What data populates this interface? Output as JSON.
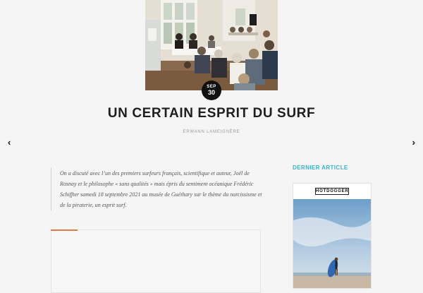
{
  "article": {
    "date_month": "SEP",
    "date_day": "30",
    "title": "UN CERTAIN ESPRIT DU SURF",
    "author": "ERWANN LAMEIGNÈRE",
    "intro": "On a discuté avec l’un des premiers surfeurs français, scientifique et auteur, Joël de Rosnay et le philosophe « sans qualités » mais épris du sentiment océanique Frédéric Schiffter samedi 18 septembre 2021 au musée de Guéthary sur le thème du narcissisme et de la piraterie, un esprit surf."
  },
  "navigation": {
    "prev_icon": "chevron-left-icon",
    "next_icon": "chevron-right-icon"
  },
  "sidebar": {
    "heading": "DERNIER ARTICLE",
    "magazine_name": "HOTDOGGER"
  },
  "colors": {
    "accent_orange": "#e07a45",
    "sidebar_heading": "#39b3cb",
    "badge_bg": "#111111"
  }
}
